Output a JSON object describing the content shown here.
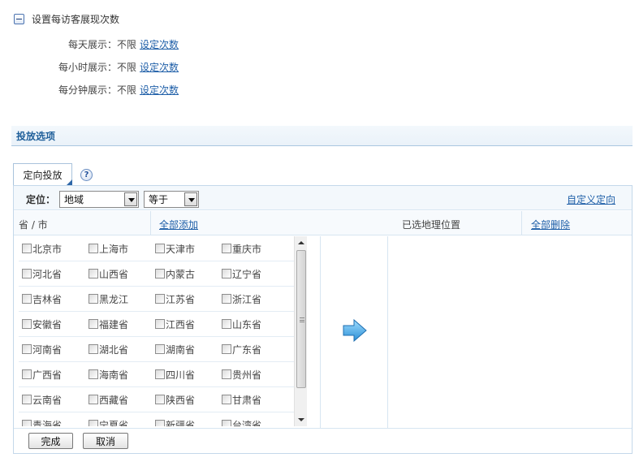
{
  "frequency": {
    "title": "设置每访客展现次数",
    "rows": [
      {
        "label": "每天展示：",
        "value": "不限",
        "link": "设定次数"
      },
      {
        "label": "每小时展示：",
        "value": "不限",
        "link": "设定次数"
      },
      {
        "label": "每分钟展示：",
        "value": "不限",
        "link": "设定次数"
      }
    ]
  },
  "section": {
    "title": "投放选项"
  },
  "tab": {
    "label": "定向投放",
    "help": "?"
  },
  "toolbar": {
    "location_label": "定位：",
    "type_select": "地域",
    "operator_select": "等于",
    "custom_link": "自定义定向"
  },
  "columns": {
    "left_header": "省 / 市",
    "add_all": "全部添加",
    "selected_header": "已选地理位置",
    "delete_all": "全部删除"
  },
  "provinces": [
    [
      "北京市",
      "上海市",
      "天津市",
      "重庆市"
    ],
    [
      "河北省",
      "山西省",
      "内蒙古",
      "辽宁省"
    ],
    [
      "吉林省",
      "黑龙江",
      "江苏省",
      "浙江省"
    ],
    [
      "安徽省",
      "福建省",
      "江西省",
      "山东省"
    ],
    [
      "河南省",
      "湖北省",
      "湖南省",
      "广东省"
    ],
    [
      "广西省",
      "海南省",
      "四川省",
      "贵州省"
    ],
    [
      "云南省",
      "西藏省",
      "陕西省",
      "甘肃省"
    ],
    [
      "青海省",
      "宁夏省",
      "新疆省",
      "台湾省"
    ]
  ],
  "footer": {
    "done": "完成",
    "cancel": "取消"
  }
}
